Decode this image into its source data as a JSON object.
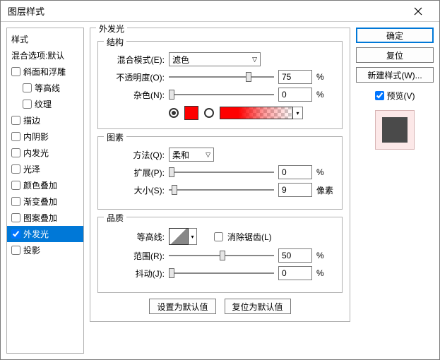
{
  "window": {
    "title": "图层样式"
  },
  "sidebar": {
    "heading": "样式",
    "sub": "混合选项:默认",
    "items": [
      {
        "label": "斜面和浮雕"
      },
      {
        "label": "等高线"
      },
      {
        "label": "纹理"
      },
      {
        "label": "描边"
      },
      {
        "label": "内阴影"
      },
      {
        "label": "内发光"
      },
      {
        "label": "光泽"
      },
      {
        "label": "颜色叠加"
      },
      {
        "label": "渐变叠加"
      },
      {
        "label": "图案叠加"
      },
      {
        "label": "外发光"
      },
      {
        "label": "投影"
      }
    ]
  },
  "panel": {
    "title": "外发光",
    "structure": {
      "legend": "结构",
      "blend_label": "混合模式(E):",
      "blend_value": "滤色",
      "opacity_label": "不透明度(O):",
      "opacity_value": "75",
      "opacity_unit": "%",
      "noise_label": "杂色(N):",
      "noise_value": "0",
      "noise_unit": "%"
    },
    "elements": {
      "legend": "图素",
      "technique_label": "方法(Q):",
      "technique_value": "柔和",
      "spread_label": "扩展(P):",
      "spread_value": "0",
      "spread_unit": "%",
      "size_label": "大小(S):",
      "size_value": "9",
      "size_unit": "像素"
    },
    "quality": {
      "legend": "品质",
      "contour_label": "等高线:",
      "antialias_label": "消除锯齿(L)",
      "range_label": "范围(R):",
      "range_value": "50",
      "range_unit": "%",
      "jitter_label": "抖动(J):",
      "jitter_value": "0",
      "jitter_unit": "%"
    },
    "buttons": {
      "make_default": "设置为默认值",
      "reset_default": "复位为默认值"
    }
  },
  "right": {
    "ok": "确定",
    "cancel": "复位",
    "new_style": "新建样式(W)...",
    "preview_label": "预览(V)"
  }
}
